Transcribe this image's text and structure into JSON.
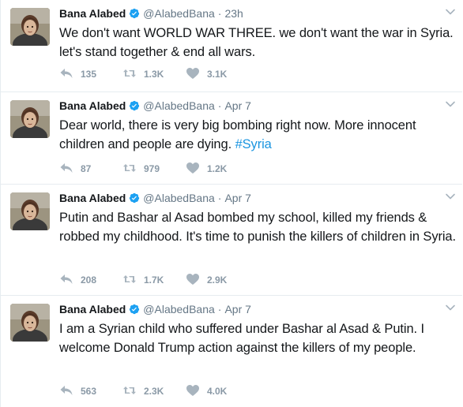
{
  "tweets": [
    {
      "name": "Bana Alabed",
      "handle": "@AlabedBana",
      "separator": "·",
      "time": "23h",
      "text": "We don't want WORLD WAR THREE. we don't want the war in Syria. let's stand together & end all wars.",
      "hashtag": "",
      "replies": "135",
      "retweets": "1.3K",
      "likes": "3.1K"
    },
    {
      "name": "Bana Alabed",
      "handle": "@AlabedBana",
      "separator": "·",
      "time": "Apr 7",
      "text": "Dear world, there is very big bombing right now. More innocent children and people are dying. ",
      "hashtag": "#Syria",
      "replies": "87",
      "retweets": "979",
      "likes": "1.2K"
    },
    {
      "name": "Bana Alabed",
      "handle": "@AlabedBana",
      "separator": "·",
      "time": "Apr 7",
      "text": "Putin and Bashar al Asad bombed my school, killed my friends & robbed my childhood. It's time to punish the killers of children in Syria.",
      "hashtag": "",
      "replies": "208",
      "retweets": "1.7K",
      "likes": "2.9K"
    },
    {
      "name": "Bana Alabed",
      "handle": "@AlabedBana",
      "separator": "·",
      "time": "Apr 7",
      "text": "I am a Syrian child who suffered under Bashar al Asad & Putin. I welcome Donald Trump action against the killers of my people.",
      "hashtag": "",
      "replies": "563",
      "retweets": "2.3K",
      "likes": "4.0K"
    }
  ],
  "colors": {
    "name": "#14171a",
    "meta": "#657786",
    "hashtag": "#1b95e0",
    "verified": "#1da1f2",
    "action": "#8a99a6",
    "border": "#e6ecf0"
  },
  "icons": {
    "reply": "reply-icon",
    "retweet": "retweet-icon",
    "like": "heart-icon",
    "caret": "chevron-down-icon",
    "verified": "verified-badge-icon"
  }
}
